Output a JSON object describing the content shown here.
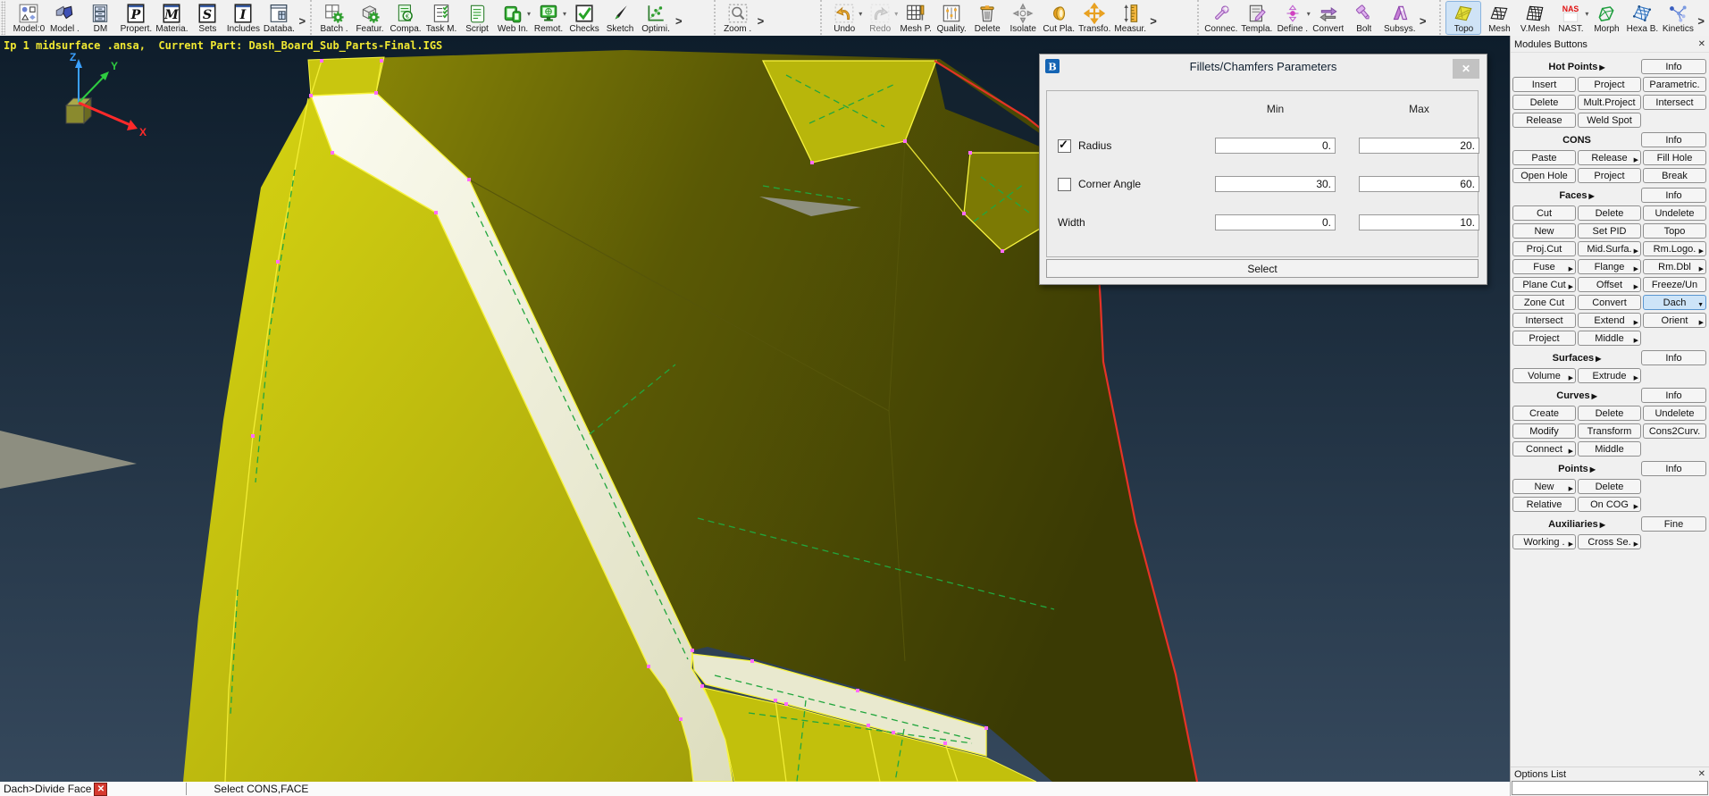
{
  "window": {
    "overlay_text": "Ip 1 midsurface .ansa,  Current Part: Dash_Board_Sub_Parts-Final.IGS"
  },
  "glyphs": {
    "chevron": ">",
    "caret": "▾",
    "submenu_right": "▶",
    "dropdown_down": "▼",
    "close": "✕",
    "check": "✓",
    "abort": "✕"
  },
  "colors": {
    "viewport_top": "#0e1d2b",
    "viewport_bottom": "#35485c",
    "surface_bright": "#cdca10",
    "surface_dark": "#4c4b04",
    "fillet_white": "#f4f4e2",
    "edge_yellow": "#f8f440",
    "cons_green": "#22a63e",
    "hot_point_magenta": "#ff6bff",
    "boundary_red": "#e53327",
    "selected_module_bg": "#cfe3f6",
    "active_button_bg": "#cde4f8",
    "overlay_text": "#f0e832"
  },
  "toolbar": {
    "groups": [
      {
        "chevron": true,
        "items": [
          {
            "label": "Model:0",
            "icon": "model-tree-icon"
          },
          {
            "label": "Model .",
            "icon": "model-icon"
          },
          {
            "label": "DM",
            "icon": "dm-icon"
          },
          {
            "label": "Propert.",
            "icon": "properties-icon"
          },
          {
            "label": "Materia.",
            "icon": "materials-icon"
          },
          {
            "label": "Sets",
            "icon": "sets-icon"
          },
          {
            "label": "Includes",
            "icon": "includes-icon"
          },
          {
            "label": "Databa.",
            "icon": "database-icon"
          }
        ]
      },
      {
        "chevron": true,
        "items": [
          {
            "label": "Batch .",
            "icon": "batch-gear-icon"
          },
          {
            "label": "Featur.",
            "icon": "feature-gear-icon"
          },
          {
            "label": "Compa.",
            "icon": "compare-doc-icon"
          },
          {
            "label": "Task M.",
            "icon": "task-manager-icon"
          },
          {
            "label": "Script",
            "icon": "script-icon"
          },
          {
            "label": "Web In.",
            "icon": "web-inspector-icon",
            "caret": true
          },
          {
            "label": "Remot.",
            "icon": "remote-icon",
            "caret": true
          },
          {
            "label": "Checks",
            "icon": "checks-icon"
          },
          {
            "label": "Sketch",
            "icon": "sketch-brush-icon"
          },
          {
            "label": "Optimi.",
            "icon": "optimizer-icon"
          }
        ]
      },
      {
        "chevron": true,
        "cls": "g3",
        "items": [
          {
            "label": "Zoom .",
            "icon": "zoom-magnifier-icon"
          }
        ]
      },
      {
        "chevron": true,
        "cls": "g4",
        "items": [
          {
            "label": "Undo",
            "icon": "undo-icon",
            "caret": true
          },
          {
            "label": "Redo",
            "icon": "redo-icon",
            "caret": true,
            "disabled": true
          },
          {
            "label": "Mesh P.",
            "icon": "mesh-params-icon"
          },
          {
            "label": "Quality.",
            "icon": "quality-criteria-icon"
          },
          {
            "label": "Delete",
            "icon": "trash-icon"
          },
          {
            "label": "Isolate",
            "icon": "isolate-icon"
          },
          {
            "label": "Cut Pla.",
            "icon": "cut-plane-icon"
          },
          {
            "label": "Transfo.",
            "icon": "transform-icon"
          },
          {
            "label": "Measur.",
            "icon": "measure-icon"
          }
        ]
      },
      {
        "chevron": true,
        "cls": "g5",
        "items": [
          {
            "label": "Connec.",
            "icon": "wrench-icon"
          },
          {
            "label": "Templa.",
            "icon": "template-pencil-icon"
          },
          {
            "label": "Define .",
            "icon": "define-icon",
            "caret": true
          },
          {
            "label": "Convert",
            "icon": "convert-arrows-icon"
          },
          {
            "label": "Bolt",
            "icon": "bolt-icon"
          },
          {
            "label": "Subsys.",
            "icon": "subsystems-icon"
          }
        ]
      },
      {
        "chevron": true,
        "cls": "g6",
        "items": [
          {
            "label": "Topo",
            "icon": "topo-module-icon",
            "selected": true
          },
          {
            "label": "Mesh",
            "icon": "mesh-module-icon"
          },
          {
            "label": "V.Mesh",
            "icon": "volume-mesh-icon"
          },
          {
            "label": "NAST.",
            "icon": "nastran-icon",
            "caret": true
          },
          {
            "label": "Morph",
            "icon": "morph-module-icon"
          },
          {
            "label": "Hexa B.",
            "icon": "hexa-block-icon"
          },
          {
            "label": "Kinetics",
            "icon": "kinetics-icon"
          }
        ]
      }
    ]
  },
  "viewport": {
    "axis": {
      "x": "X",
      "y": "Y",
      "z": "Z"
    }
  },
  "dialog": {
    "title": "Fillets/Chamfers Parameters",
    "columns": {
      "min": "Min",
      "max": "Max"
    },
    "rows": [
      {
        "label": "Radius",
        "checkbox": true,
        "checked": true,
        "min": "0.",
        "max": "20."
      },
      {
        "label": "Corner Angle",
        "checkbox": true,
        "checked": false,
        "min": "30.",
        "max": "60."
      },
      {
        "label": "Width",
        "checkbox": false,
        "min": "0.",
        "max": "10."
      }
    ],
    "select_label": "Select"
  },
  "sidebar": {
    "header": "Modules Buttons",
    "options_header": "Options List",
    "groups": [
      {
        "title": "Hot Points",
        "title_arrow": true,
        "side": "Info",
        "rows": [
          [
            {
              "l": "Insert"
            },
            {
              "l": "Project"
            },
            {
              "l": "Parametric."
            }
          ],
          [
            {
              "l": "Delete"
            },
            {
              "l": "Mult.Project"
            },
            {
              "l": "Intersect"
            }
          ],
          [
            {
              "l": "Release"
            },
            {
              "l": "Weld Spot"
            },
            null
          ]
        ]
      },
      {
        "title": "CONS",
        "title_arrow": false,
        "side": "Info",
        "rows": [
          [
            {
              "l": "Paste"
            },
            {
              "l": "Release",
              "a": "r"
            },
            {
              "l": "Fill Hole"
            }
          ],
          [
            {
              "l": "Open Hole"
            },
            {
              "l": "Project"
            },
            {
              "l": "Break"
            }
          ]
        ]
      },
      {
        "title": "Faces",
        "title_arrow": true,
        "side": "Info",
        "rows": [
          [
            {
              "l": "Cut"
            },
            {
              "l": "Delete"
            },
            {
              "l": "Undelete"
            }
          ],
          [
            {
              "l": "New"
            },
            {
              "l": "Set PID"
            },
            {
              "l": "Topo"
            }
          ],
          [
            {
              "l": "Proj.Cut"
            },
            {
              "l": "Mid.Surfa.",
              "a": "r"
            },
            {
              "l": "Rm.Logo.",
              "a": "r"
            }
          ],
          [
            {
              "l": "Fuse",
              "a": "r"
            },
            {
              "l": "Flange",
              "a": "r"
            },
            {
              "l": "Rm.Dbl",
              "a": "r"
            }
          ],
          [
            {
              "l": "Plane Cut",
              "a": "r"
            },
            {
              "l": "Offset",
              "a": "r"
            },
            {
              "l": "Freeze/Un"
            }
          ],
          [
            {
              "l": "Zone Cut"
            },
            {
              "l": "Convert"
            },
            {
              "l": "Dach",
              "a": "d",
              "hl": true
            }
          ],
          [
            {
              "l": "Intersect"
            },
            {
              "l": "Extend",
              "a": "r"
            },
            {
              "l": "Orient",
              "a": "r"
            }
          ],
          [
            {
              "l": "Project"
            },
            {
              "l": "Middle",
              "a": "r"
            },
            null
          ]
        ]
      },
      {
        "title": "Surfaces",
        "title_arrow": true,
        "side": "Info",
        "rows": [
          [
            {
              "l": "Volume",
              "a": "r"
            },
            {
              "l": "Extrude",
              "a": "r"
            },
            null
          ]
        ]
      },
      {
        "title": "Curves",
        "title_arrow": true,
        "side": "Info",
        "rows": [
          [
            {
              "l": "Create"
            },
            {
              "l": "Delete"
            },
            {
              "l": "Undelete"
            }
          ],
          [
            {
              "l": "Modify"
            },
            {
              "l": "Transform"
            },
            {
              "l": "Cons2Curv."
            }
          ],
          [
            {
              "l": "Connect",
              "a": "r"
            },
            {
              "l": "Middle"
            },
            null
          ]
        ]
      },
      {
        "title": "Points",
        "title_arrow": true,
        "side": "Info",
        "rows": [
          [
            {
              "l": "New",
              "a": "r"
            },
            {
              "l": "Delete"
            },
            null
          ],
          [
            {
              "l": "Relative"
            },
            {
              "l": "On COG",
              "a": "r"
            },
            null
          ]
        ]
      },
      {
        "title": "Auxiliaries",
        "title_arrow": true,
        "side": "Fine",
        "rows": [
          [
            {
              "l": "Working .",
              "a": "r"
            },
            {
              "l": "Cross Se.",
              "a": "r"
            },
            null
          ]
        ]
      }
    ]
  },
  "statusbar": {
    "breadcrumb": "Dach>Divide Face",
    "hint": "Select CONS,FACE"
  }
}
